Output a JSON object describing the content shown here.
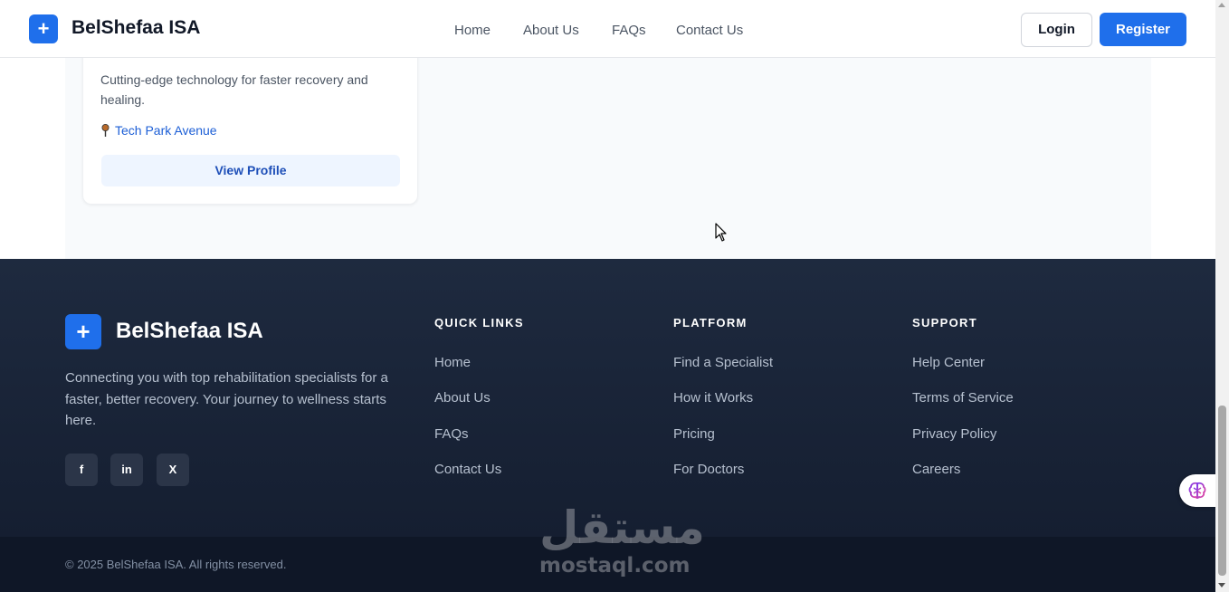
{
  "header": {
    "logo_icon": "plus-icon",
    "brand": "BelShefaa ISA",
    "nav": [
      "Home",
      "About Us",
      "FAQs",
      "Contact Us"
    ],
    "login_label": "Login",
    "register_label": "Register"
  },
  "card": {
    "description": "Cutting-edge technology for faster recovery and healing.",
    "location_icon": "map-pin-icon",
    "location": "Tech Park Avenue",
    "view_profile_label": "View Profile"
  },
  "footer": {
    "logo_icon": "plus-icon",
    "brand": "BelShefaa ISA",
    "description": "Connecting you with top rehabilitation specialists for a faster, better recovery. Your journey to wellness starts here.",
    "social": [
      "f",
      "in",
      "X"
    ],
    "columns": [
      {
        "title": "QUICK LINKS",
        "links": [
          "Home",
          "About Us",
          "FAQs",
          "Contact Us"
        ]
      },
      {
        "title": "PLATFORM",
        "links": [
          "Find a Specialist",
          "How it Works",
          "Pricing",
          "For Doctors"
        ]
      },
      {
        "title": "SUPPORT",
        "links": [
          "Help Center",
          "Terms of Service",
          "Privacy Policy",
          "Careers"
        ]
      }
    ],
    "copyright": "© 2025 BelShefaa ISA. All rights reserved."
  },
  "watermark": {
    "arabic": "مستقل",
    "latin": "mostaql.com"
  },
  "widget": {
    "icon": "brain-icon"
  },
  "colors": {
    "primary": "#1f6feb",
    "footer_bg": "#1e2a3f",
    "link": "#1d5fd6"
  }
}
